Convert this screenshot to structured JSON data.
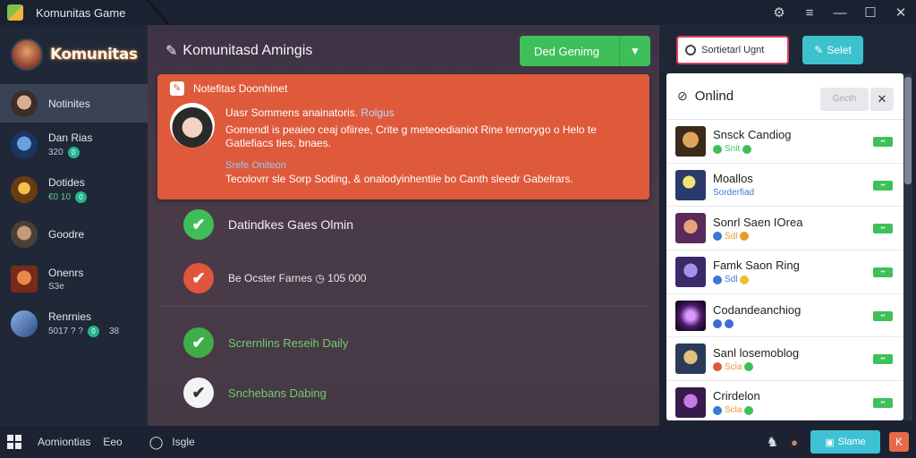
{
  "window": {
    "title": "Komunitas Game",
    "controls": {
      "settings": "⚙",
      "menu": "≡",
      "minimize": "—",
      "maximize": "☐",
      "close": "✕"
    }
  },
  "sidebar": {
    "logo_text": "Komunitas",
    "items": [
      {
        "label": "Notinites",
        "meta": "",
        "badge": "",
        "extra": ""
      },
      {
        "label": "Dan Rias",
        "meta": "320",
        "badge": "0",
        "extra": ""
      },
      {
        "label": "Dotides",
        "meta": "€0 10",
        "badge": "0",
        "extra": ""
      },
      {
        "label": "Goodre",
        "meta": "",
        "badge": "",
        "extra": ""
      },
      {
        "label": "Onenrs",
        "meta": "S3e",
        "badge": "",
        "extra": ""
      },
      {
        "label": "Renrnies",
        "meta": "5017 ? ?",
        "badge": "0",
        "extra": "38"
      }
    ]
  },
  "main": {
    "title": "Komunitasd Amingis",
    "cta_label": "Ded Genimg",
    "notice": {
      "title": "Notefitas Doonhinet",
      "line1": "Uasr Sommens anainatoris.",
      "line1_link": "Rolgus",
      "body": "Gomendl is peaieo ceaj ofiiree, Crite g meteoedianiot Rine temorygo o Helo te Gatlefiacs ties, bnaes.",
      "sublink": "Srefe Oniteon",
      "footer": "Tecolovrr sle Sorp Soding, & onalodyinhentiie bo Canth sleedr Gabelrars."
    },
    "checks": [
      {
        "label": "Datindkes Gaes Olmin",
        "color": "#3fbe58",
        "label_color": "#f0f1f4",
        "mark": "✔"
      },
      {
        "label": "Be Ocster Farnes  ◷ 105 000",
        "color": "#e0563c",
        "label_color": "#e8e8ec",
        "mark": "✔"
      },
      {
        "label": "Scrernlins Reseih Daily",
        "color": "#3fae48",
        "label_color": "#6fcf6a",
        "mark": "✔"
      },
      {
        "label": "Snchebans Dabing",
        "color": "#f3f3f5",
        "label_color": "#6fcf6a",
        "mark": "✔"
      }
    ]
  },
  "right": {
    "search_placeholder": "Sortietarl Ugnt",
    "select_label": "Selet",
    "online": {
      "title": "Onlind",
      "search_label": "Gecth",
      "close": "✕",
      "friends": [
        {
          "name": "Snsck Candiog",
          "sub": "Snit",
          "accent": "#3fbe58",
          "btn": "••"
        },
        {
          "name": "Moallos",
          "sub": "Sorderfiad",
          "accent": "#3a78d6",
          "btn": "••"
        },
        {
          "name": "Sonrl Saen IOrea",
          "sub": "Sdl",
          "accent": "#e79a2a",
          "btn": "••"
        },
        {
          "name": "Famk Saon Ring",
          "sub": "Sdl",
          "accent": "#e7c12a",
          "btn": "••"
        },
        {
          "name": "Codandeanchiog",
          "sub": "",
          "accent": "#3f6ad6",
          "btn": "••"
        },
        {
          "name": "Sanl losemoblog",
          "sub": "Scla",
          "accent": "#e79a2a",
          "btn": "••"
        },
        {
          "name": "Crirdelon",
          "sub": "Scla",
          "accent": "#e79a2a",
          "btn": "••"
        }
      ]
    }
  },
  "taskbar": {
    "items": [
      "Aomiontias",
      "Eeo",
      "Isgle"
    ],
    "chip_label": "Slame",
    "red_label": "K"
  }
}
